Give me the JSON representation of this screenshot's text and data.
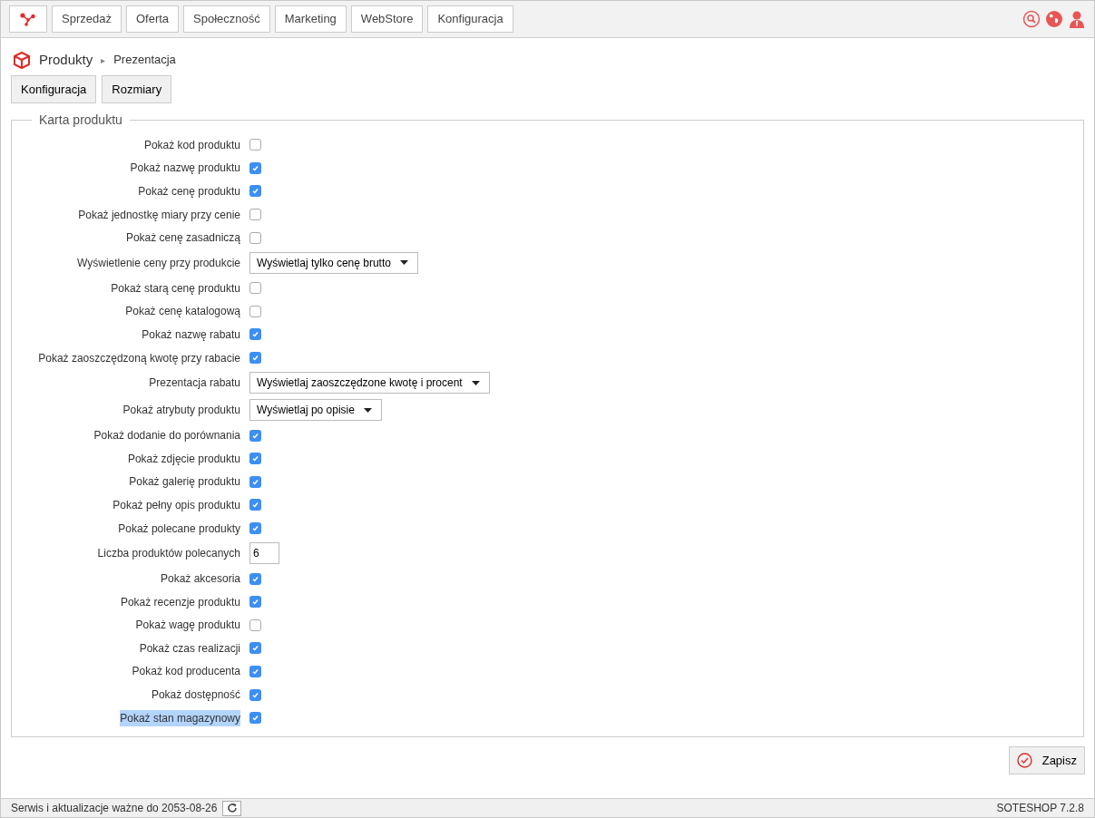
{
  "nav": {
    "items": [
      "Sprzedaż",
      "Oferta",
      "Społeczność",
      "Marketing",
      "WebStore",
      "Konfiguracja"
    ]
  },
  "breadcrumb": {
    "section": "Produkty",
    "separator": "▸",
    "page": "Prezentacja"
  },
  "subtabs": [
    "Konfiguracja",
    "Rozmiary"
  ],
  "fieldset": {
    "legend": "Karta produktu",
    "rows": [
      {
        "kind": "checkbox",
        "label": "Pokaż kod produktu",
        "checked": false,
        "highlighted": false
      },
      {
        "kind": "checkbox",
        "label": "Pokaż nazwę produktu",
        "checked": true,
        "highlighted": false
      },
      {
        "kind": "checkbox",
        "label": "Pokaż cenę produktu",
        "checked": true,
        "highlighted": false
      },
      {
        "kind": "checkbox",
        "label": "Pokaż jednostkę miary przy cenie",
        "checked": false,
        "highlighted": false
      },
      {
        "kind": "checkbox",
        "label": "Pokaż cenę zasadniczą",
        "checked": false,
        "highlighted": false
      },
      {
        "kind": "select",
        "label": "Wyświetlenie ceny przy produkcie",
        "value": "Wyświetlaj tylko cenę brutto",
        "highlighted": false
      },
      {
        "kind": "checkbox",
        "label": "Pokaż starą cenę produktu",
        "checked": false,
        "highlighted": false
      },
      {
        "kind": "checkbox",
        "label": "Pokaż cenę katalogową",
        "checked": false,
        "highlighted": false
      },
      {
        "kind": "checkbox",
        "label": "Pokaż nazwę rabatu",
        "checked": true,
        "highlighted": false
      },
      {
        "kind": "checkbox",
        "label": "Pokaż zaoszczędzoną kwotę przy rabacie",
        "checked": true,
        "highlighted": false
      },
      {
        "kind": "select",
        "label": "Prezentacja rabatu",
        "value": "Wyświetlaj zaoszczędzone kwotę i procent",
        "highlighted": false
      },
      {
        "kind": "select",
        "label": "Pokaż atrybuty produktu",
        "value": "Wyświetlaj po opisie",
        "highlighted": false
      },
      {
        "kind": "checkbox",
        "label": "Pokaż dodanie do porównania",
        "checked": true,
        "highlighted": false
      },
      {
        "kind": "checkbox",
        "label": "Pokaż zdjęcie produktu",
        "checked": true,
        "highlighted": false
      },
      {
        "kind": "checkbox",
        "label": "Pokaż galerię produktu",
        "checked": true,
        "highlighted": false
      },
      {
        "kind": "checkbox",
        "label": "Pokaż pełny opis produktu",
        "checked": true,
        "highlighted": false
      },
      {
        "kind": "checkbox",
        "label": "Pokaż polecane produkty",
        "checked": true,
        "highlighted": false
      },
      {
        "kind": "number",
        "label": "Liczba produktów polecanych",
        "value": "6",
        "highlighted": false
      },
      {
        "kind": "checkbox",
        "label": "Pokaż akcesoria",
        "checked": true,
        "highlighted": false
      },
      {
        "kind": "checkbox",
        "label": "Pokaż recenzje produktu",
        "checked": true,
        "highlighted": false
      },
      {
        "kind": "checkbox",
        "label": "Pokaż wagę produktu",
        "checked": false,
        "highlighted": false
      },
      {
        "kind": "checkbox",
        "label": "Pokaż czas realizacji",
        "checked": true,
        "highlighted": false
      },
      {
        "kind": "checkbox",
        "label": "Pokaż kod producenta",
        "checked": true,
        "highlighted": false
      },
      {
        "kind": "checkbox",
        "label": "Pokaż dostępność",
        "checked": true,
        "highlighted": false
      },
      {
        "kind": "checkbox",
        "label": "Pokaż stan magazynowy",
        "checked": true,
        "highlighted": true
      }
    ]
  },
  "save_button": "Zapisz",
  "status_bar": {
    "license": "Serwis i aktualizacje ważne do 2053-08-26",
    "version": "SOTESHOP 7.2.8"
  }
}
